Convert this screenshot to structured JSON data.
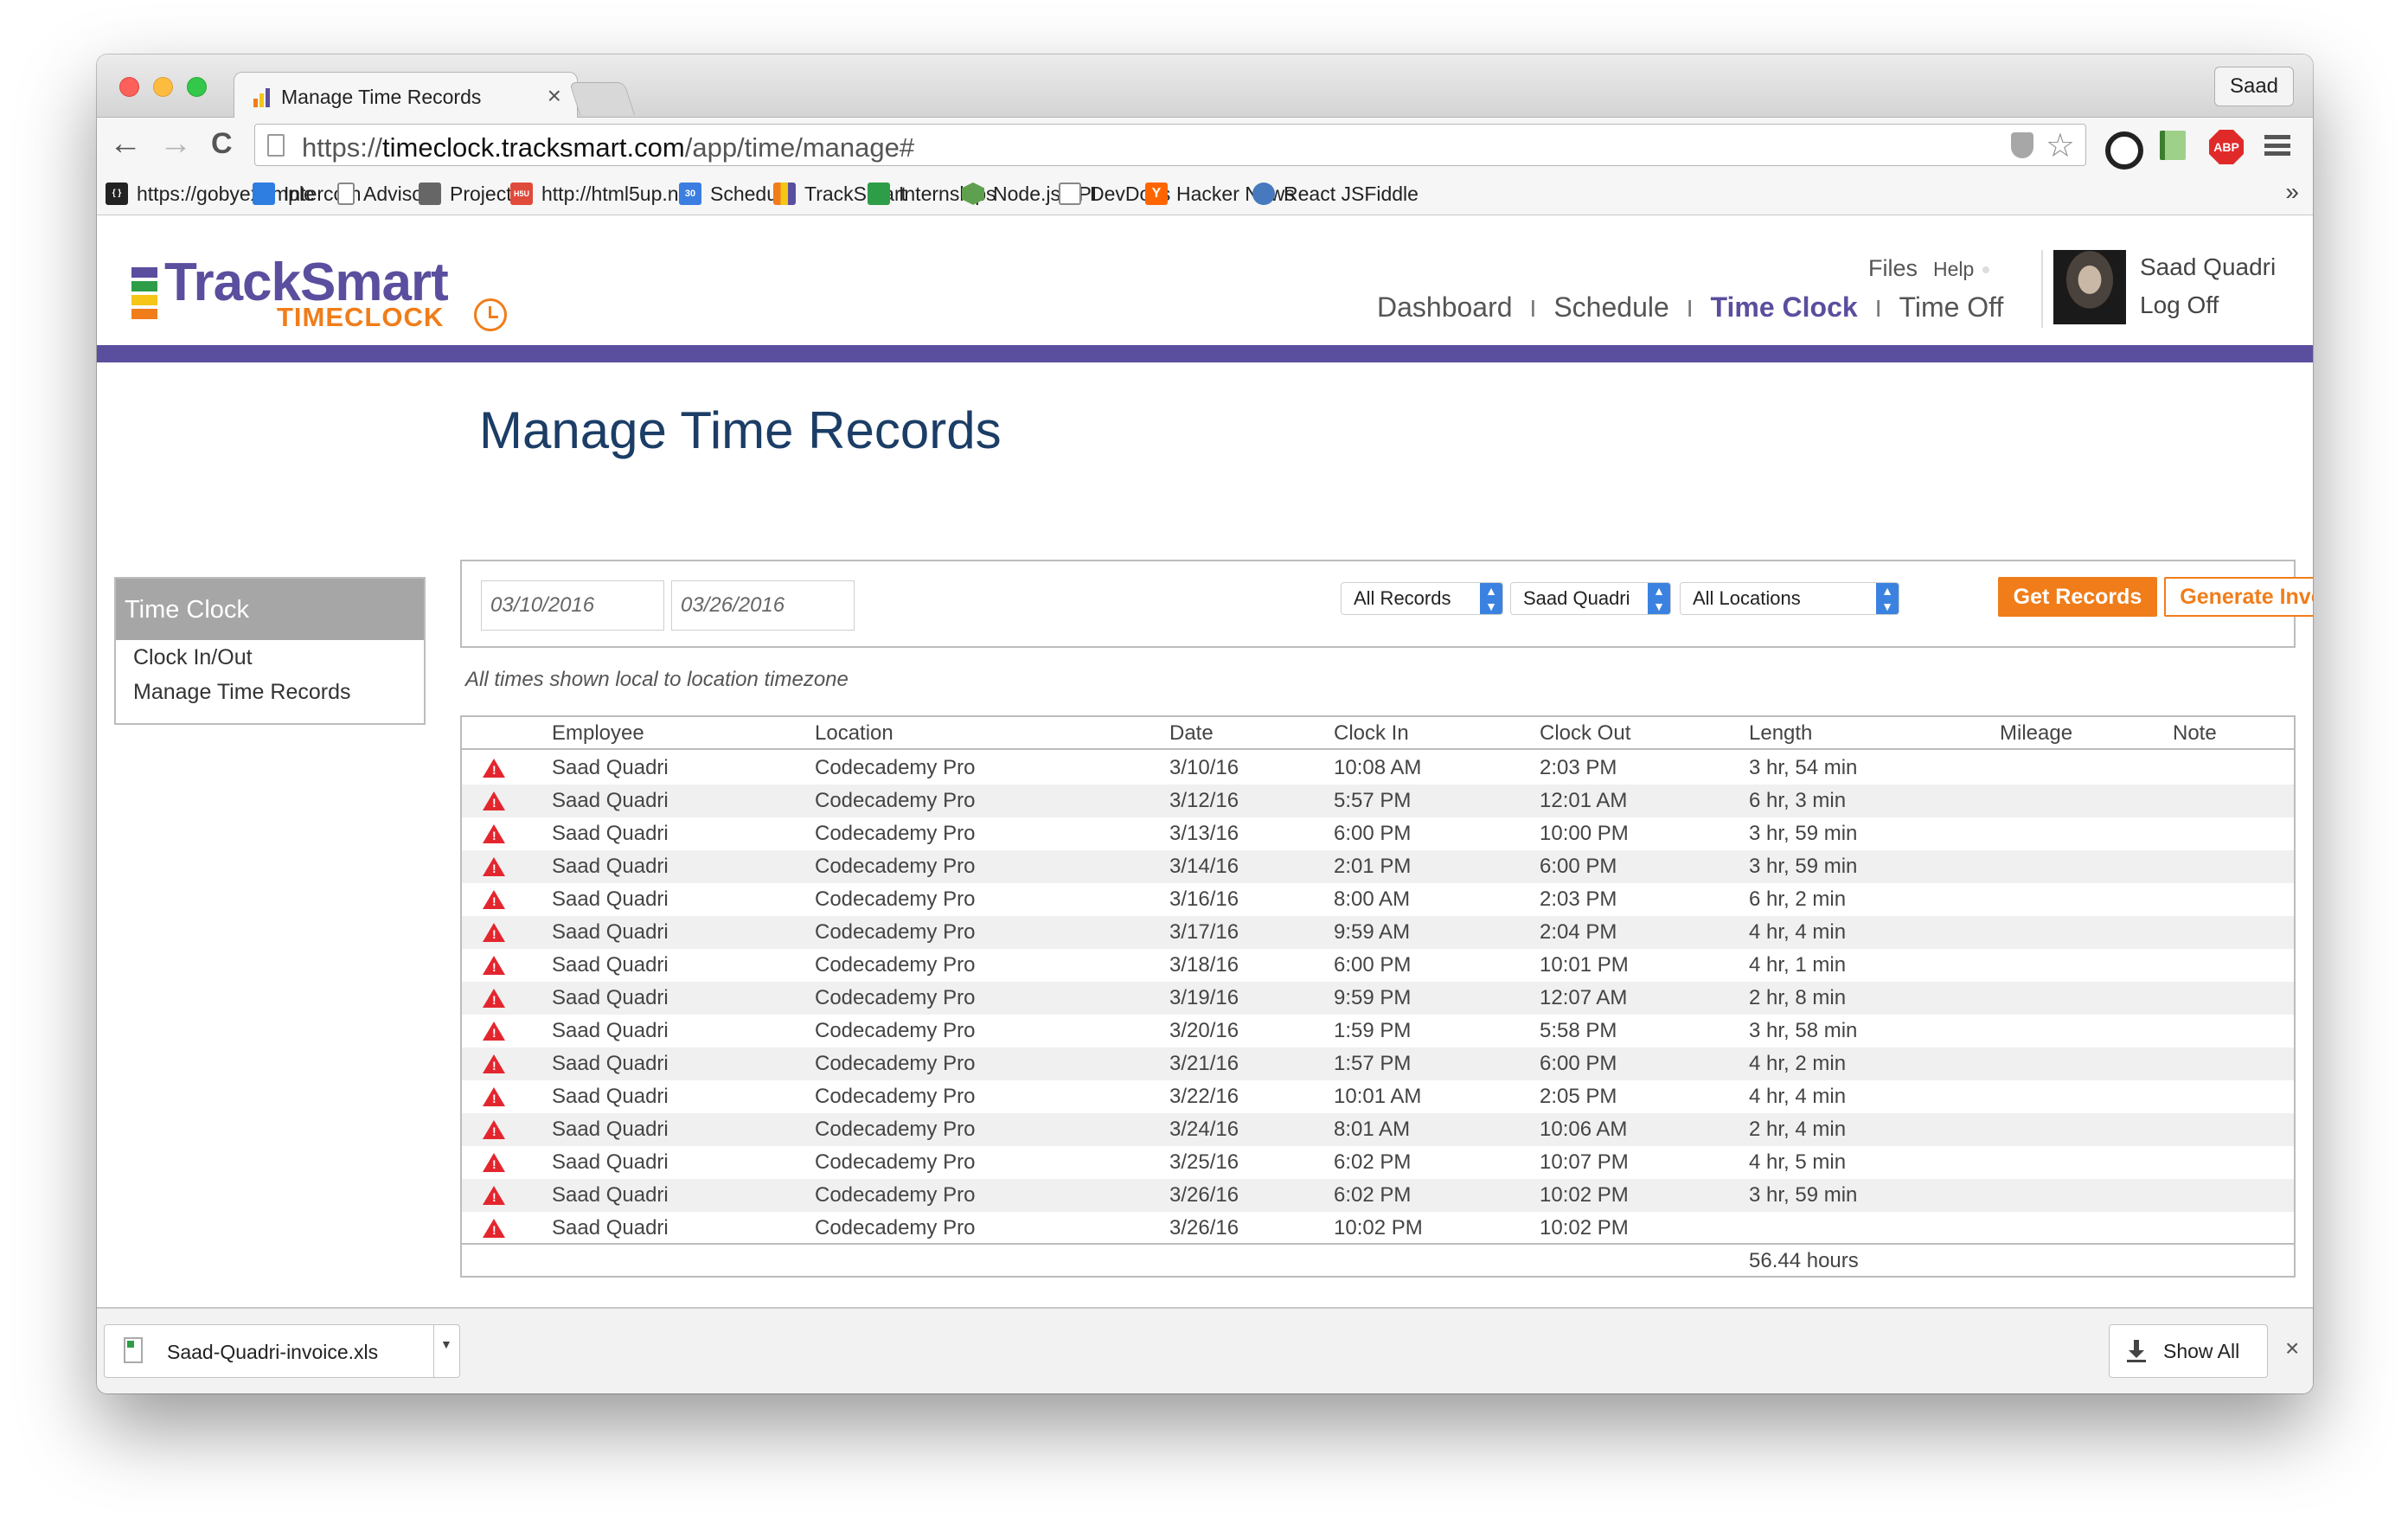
{
  "browser": {
    "tab_title": "Manage Time Records",
    "tab_close": "×",
    "profile": "Saad",
    "url_scheme": "https://",
    "url_host": "timeclock.tracksmart.com",
    "url_path": "/app/time/manage#",
    "nav": {
      "back": "←",
      "forward": "→",
      "reload": "C"
    },
    "star": "☆",
    "abp": "ABP"
  },
  "bookmarks": [
    {
      "label": "https://gobyexample",
      "icon": "gobyexample-icon",
      "color": "#222222",
      "glyph": "{ }"
    },
    {
      "label": "Intercom",
      "icon": "intercom-icon",
      "color": "#2e7de1",
      "glyph": ""
    },
    {
      "label": "Advisors",
      "icon": "page-icon",
      "color": "#ffffff",
      "glyph": ""
    },
    {
      "label": "Projects",
      "icon": "folder-icon",
      "color": "#666666",
      "glyph": ""
    },
    {
      "label": "http://html5up.net/",
      "icon": "html5up-icon",
      "color": "#e04a3b",
      "glyph": "H5U"
    },
    {
      "label": "Schedule",
      "icon": "calendar-icon",
      "color": "#3b7de0",
      "glyph": "30"
    },
    {
      "label": "TrackSmart",
      "icon": "tracksmart-icon",
      "color": "#5a4e9e",
      "glyph": ""
    },
    {
      "label": "Internships",
      "icon": "sheets-icon",
      "color": "#2e9d47",
      "glyph": ""
    },
    {
      "label": "Node.js API",
      "icon": "nodejs-icon",
      "color": "#5fa04e",
      "glyph": ""
    },
    {
      "label": "DevDocs",
      "icon": "devdocs-icon",
      "color": "#888888",
      "glyph": ""
    },
    {
      "label": "Hacker News",
      "icon": "hackernews-icon",
      "color": "#ff6600",
      "glyph": "Y"
    },
    {
      "label": "React JSFiddle",
      "icon": "jsfiddle-icon",
      "color": "#4679bd",
      "glyph": ""
    }
  ],
  "bookmarks_more": "»",
  "app": {
    "brand": "TrackSmart",
    "brand_sub": "TIMECLOCK",
    "brand_color": "#5a4e9e",
    "accent_color": "#f07d1a",
    "top_links": {
      "files": "Files",
      "help": "Help"
    },
    "nav": [
      {
        "label": "Dashboard",
        "active": false
      },
      {
        "label": "Schedule",
        "active": false
      },
      {
        "label": "Time Clock",
        "active": true
      },
      {
        "label": "Time Off",
        "active": false
      }
    ],
    "nav_sep": "I",
    "user": {
      "name": "Saad Quadri",
      "logout": "Log Off"
    }
  },
  "page_title": "Manage Time Records",
  "sidebar": {
    "heading": "Time Clock",
    "items": [
      "Clock In/Out",
      "Manage Time Records"
    ]
  },
  "filters": {
    "start_date": "03/10/2016",
    "end_date": "03/26/2016",
    "records": "All Records",
    "employee": "Saad Quadri",
    "location": "All Locations",
    "get_records": "Get Records",
    "generate_invoice": "Generate Invoice"
  },
  "timezone_note": "All times shown local to location timezone",
  "table": {
    "columns": [
      "Employee",
      "Location",
      "Date",
      "Clock In",
      "Clock Out",
      "Length",
      "Mileage",
      "Note"
    ],
    "rows": [
      [
        "Saad Quadri",
        "Codecademy Pro",
        "3/10/16",
        "10:08 AM",
        "2:03 PM",
        "3 hr, 54 min"
      ],
      [
        "Saad Quadri",
        "Codecademy Pro",
        "3/12/16",
        "5:57 PM",
        "12:01 AM",
        "6 hr, 3 min"
      ],
      [
        "Saad Quadri",
        "Codecademy Pro",
        "3/13/16",
        "6:00 PM",
        "10:00 PM",
        "3 hr, 59 min"
      ],
      [
        "Saad Quadri",
        "Codecademy Pro",
        "3/14/16",
        "2:01 PM",
        "6:00 PM",
        "3 hr, 59 min"
      ],
      [
        "Saad Quadri",
        "Codecademy Pro",
        "3/16/16",
        "8:00 AM",
        "2:03 PM",
        "6 hr, 2 min"
      ],
      [
        "Saad Quadri",
        "Codecademy Pro",
        "3/17/16",
        "9:59 AM",
        "2:04 PM",
        "4 hr, 4 min"
      ],
      [
        "Saad Quadri",
        "Codecademy Pro",
        "3/18/16",
        "6:00 PM",
        "10:01 PM",
        "4 hr, 1 min"
      ],
      [
        "Saad Quadri",
        "Codecademy Pro",
        "3/19/16",
        "9:59 PM",
        "12:07 AM",
        "2 hr, 8 min"
      ],
      [
        "Saad Quadri",
        "Codecademy Pro",
        "3/20/16",
        "1:59 PM",
        "5:58 PM",
        "3 hr, 58 min"
      ],
      [
        "Saad Quadri",
        "Codecademy Pro",
        "3/21/16",
        "1:57 PM",
        "6:00 PM",
        "4 hr, 2 min"
      ],
      [
        "Saad Quadri",
        "Codecademy Pro",
        "3/22/16",
        "10:01 AM",
        "2:05 PM",
        "4 hr, 4 min"
      ],
      [
        "Saad Quadri",
        "Codecademy Pro",
        "3/24/16",
        "8:01 AM",
        "10:06 AM",
        "2 hr, 4 min"
      ],
      [
        "Saad Quadri",
        "Codecademy Pro",
        "3/25/16",
        "6:02 PM",
        "10:07 PM",
        "4 hr, 5 min"
      ],
      [
        "Saad Quadri",
        "Codecademy Pro",
        "3/26/16",
        "6:02 PM",
        "10:02 PM",
        "3 hr, 59 min"
      ],
      [
        "Saad Quadri",
        "Codecademy Pro",
        "3/26/16",
        "10:02 PM",
        "10:02 PM",
        ""
      ]
    ],
    "total": "56.44 hours"
  },
  "downloads": {
    "file": "Saad-Quadri-invoice.xls",
    "show_all": "Show All",
    "close": "×"
  }
}
